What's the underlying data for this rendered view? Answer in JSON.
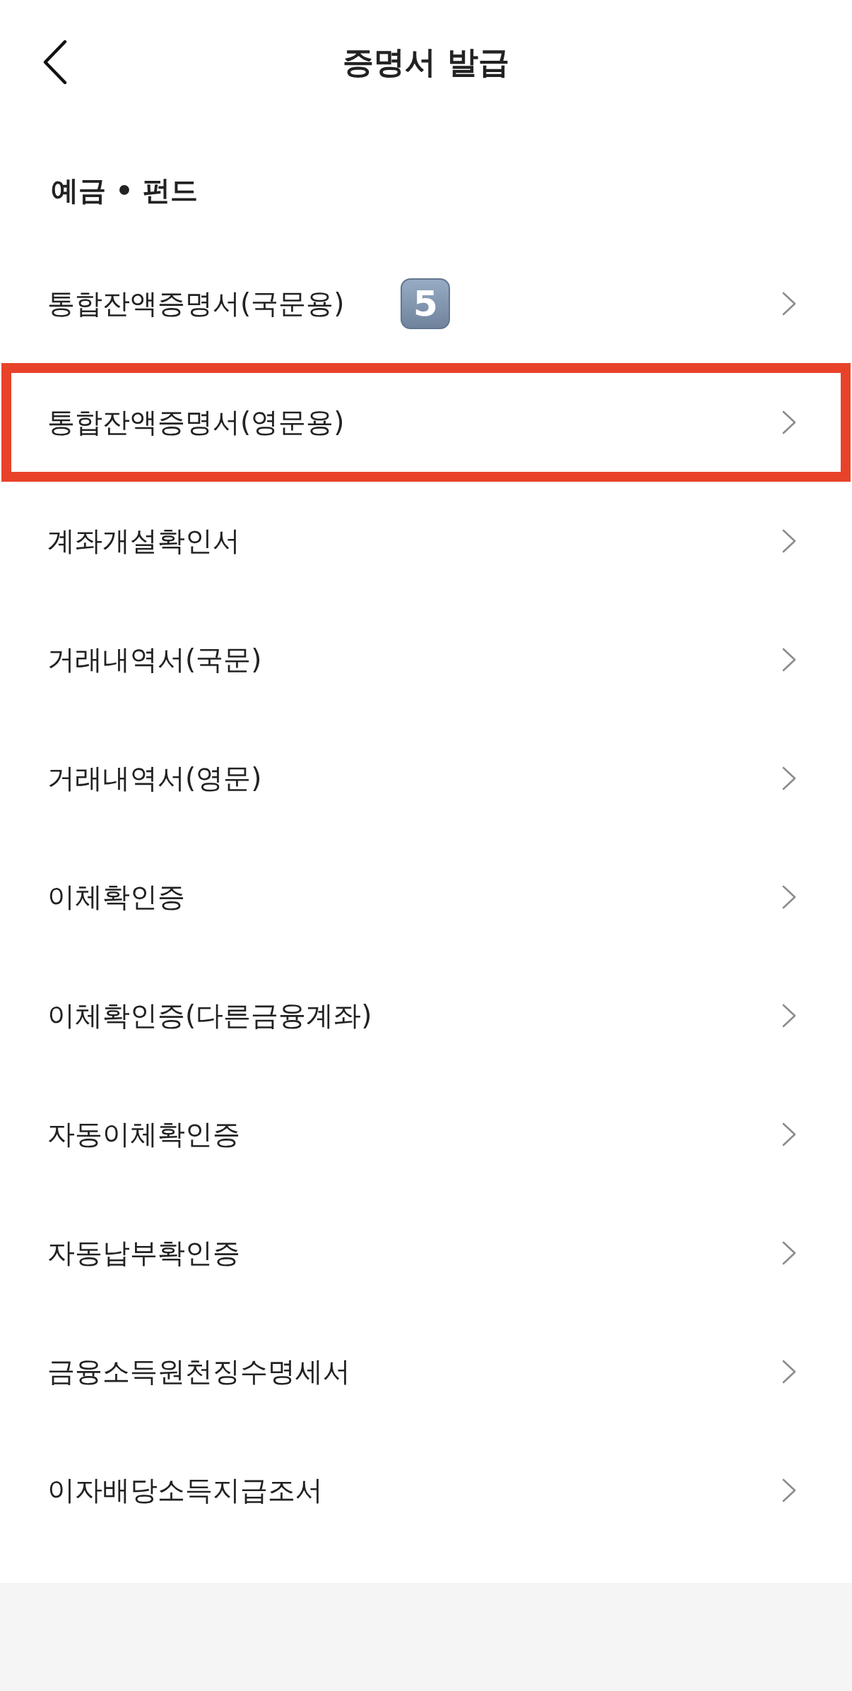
{
  "header": {
    "title": "증명서 발급"
  },
  "section": {
    "title": "예금 • 펀드",
    "items": [
      {
        "label": "통합잔액증명서(국문용)",
        "badge": "5",
        "highlighted": false
      },
      {
        "label": "통합잔액증명서(영문용)",
        "highlighted": true
      },
      {
        "label": "계좌개설확인서",
        "highlighted": false
      },
      {
        "label": "거래내역서(국문)",
        "highlighted": false
      },
      {
        "label": "거래내역서(영문)",
        "highlighted": false
      },
      {
        "label": "이체확인증",
        "highlighted": false
      },
      {
        "label": "이체확인증(다른금융계좌)",
        "highlighted": false
      },
      {
        "label": "자동이체확인증",
        "highlighted": false
      },
      {
        "label": "자동납부확인증",
        "highlighted": false
      },
      {
        "label": "금융소득원천징수명세서",
        "highlighted": false
      },
      {
        "label": "이자배당소득지급조서",
        "highlighted": false
      }
    ]
  }
}
